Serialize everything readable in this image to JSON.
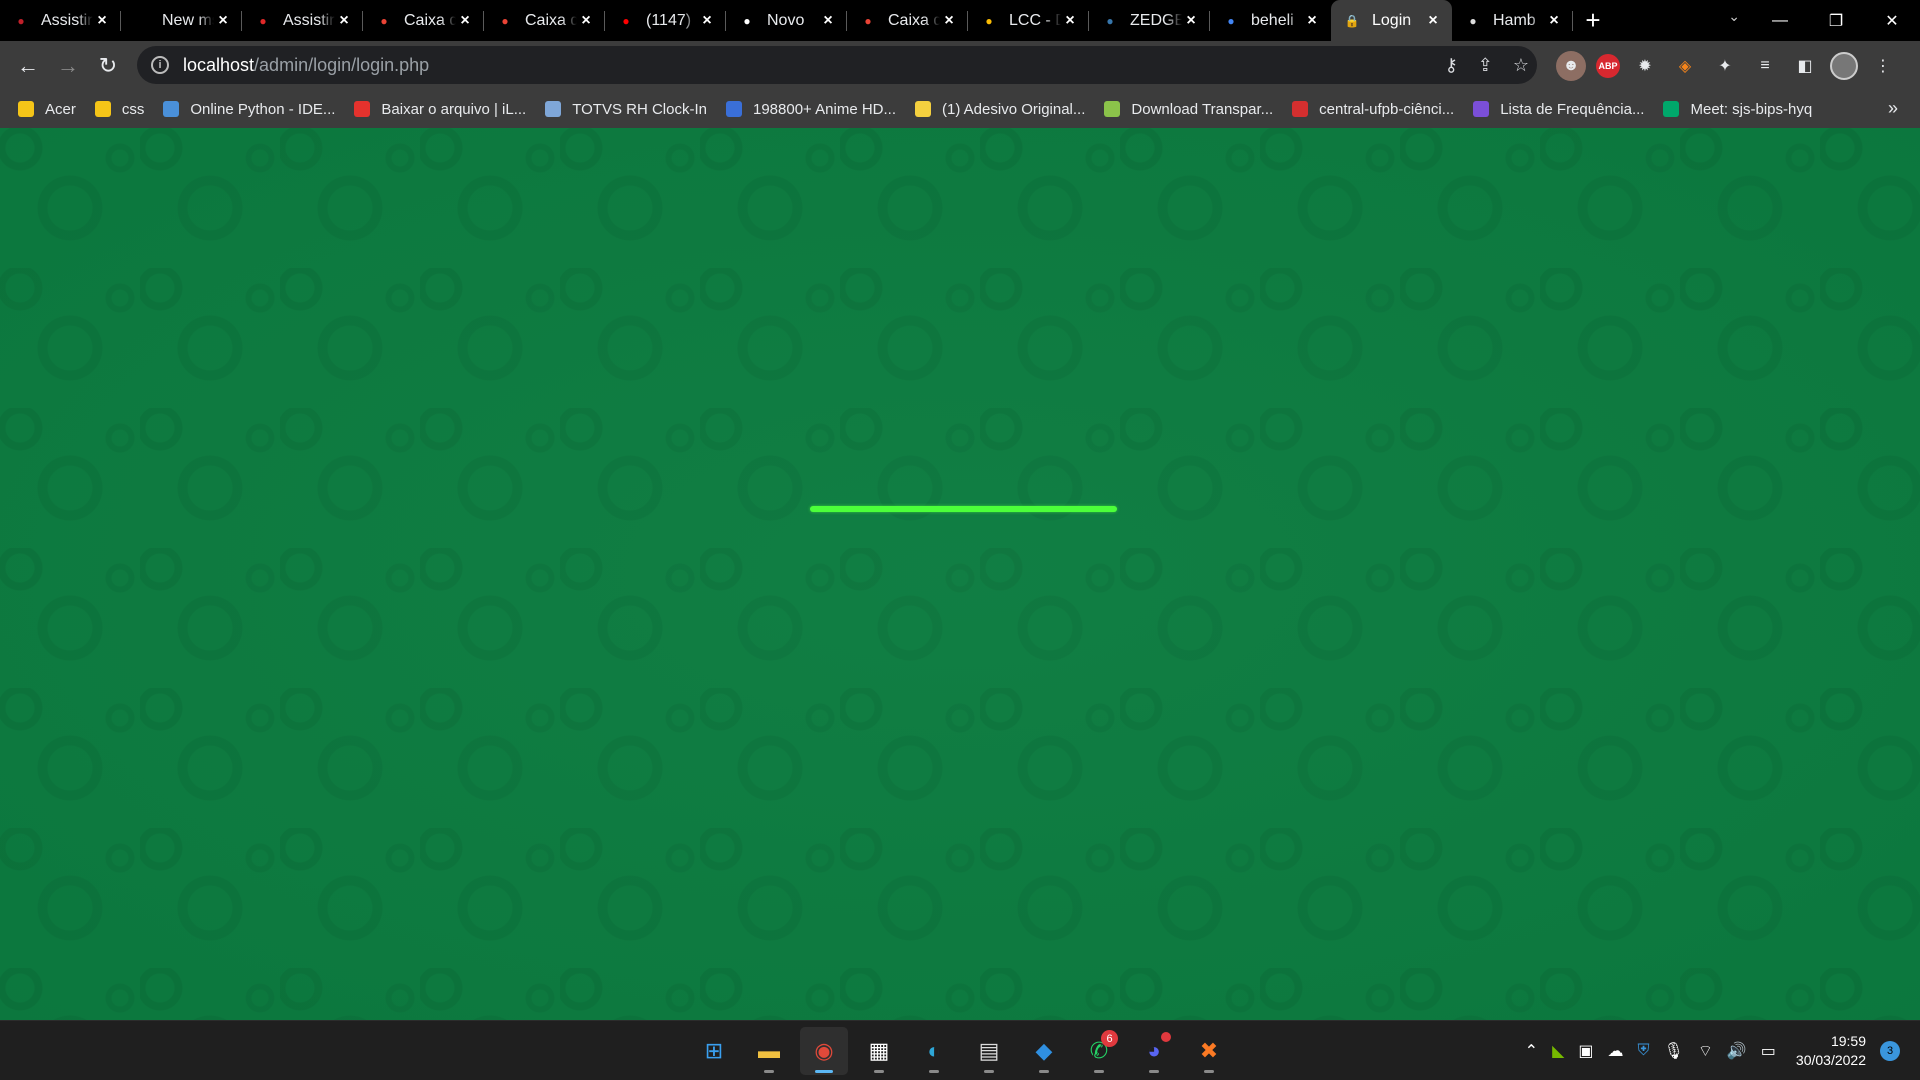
{
  "browser": {
    "tabs": [
      {
        "title": "Assistir",
        "favicon": "anime-site-icon",
        "color": "#c0202a"
      },
      {
        "title": "New msg",
        "favicon": "blank-icon",
        "color": "#000000"
      },
      {
        "title": "Assistir",
        "favicon": "youtube-style-icon",
        "color": "#e02828"
      },
      {
        "title": "Caixa de entrada",
        "favicon": "gmail-icon",
        "color": "#ea4335"
      },
      {
        "title": "Caixa de entrada",
        "favicon": "gmail-icon",
        "color": "#ea4335"
      },
      {
        "title": "(1147)",
        "favicon": "youtube-icon",
        "color": "#ff0000"
      },
      {
        "title": "Novo",
        "favicon": "github-icon",
        "color": "#ffffff"
      },
      {
        "title": "Caixa de entrada",
        "favicon": "gmail-icon",
        "color": "#ea4335"
      },
      {
        "title": "LCC - Drive",
        "favicon": "drive-icon",
        "color": "#fbbc04"
      },
      {
        "title": "ZEDGE",
        "favicon": "python-icon",
        "color": "#3776ab"
      },
      {
        "title": "beheli",
        "favicon": "google-icon",
        "color": "#4285f4"
      },
      {
        "title": "Login",
        "favicon": "lock-icon",
        "color": "#f5c518",
        "active": true
      },
      {
        "title": "Hamb",
        "favicon": "page-icon",
        "color": "#dddddd"
      }
    ],
    "url_host": "localhost",
    "url_path": "/admin/login/login.php",
    "bookmarks": [
      {
        "label": "Acer",
        "color": "#f5c518"
      },
      {
        "label": "css",
        "color": "#f5c518"
      },
      {
        "label": "Online Python - IDE...",
        "color": "#4a90d9"
      },
      {
        "label": "Baixar o arquivo | iL...",
        "color": "#e5322d"
      },
      {
        "label": "TOTVS RH Clock-In",
        "color": "#7fa7d8"
      },
      {
        "label": "198800+ Anime HD...",
        "color": "#3a6fd8"
      },
      {
        "label": "(1) Adesivo Original...",
        "color": "#f4d03f"
      },
      {
        "label": "Download Transpar...",
        "color": "#8bc34a"
      },
      {
        "label": "central-ufpb-ciênci...",
        "color": "#d32f2f"
      },
      {
        "label": "Lista de Frequência...",
        "color": "#7b4fd8"
      },
      {
        "label": "Meet: sjs-bips-hyq",
        "color": "#00a86b"
      }
    ]
  },
  "page": {
    "loader_color": "#4cff3a",
    "background_color": "#0c7c40"
  },
  "taskbar": {
    "apps": [
      {
        "name": "windows-start-icon",
        "glyph": "⊞",
        "color": "#3aa0f0"
      },
      {
        "name": "file-explorer-icon",
        "glyph": "▬",
        "color": "#f0c040"
      },
      {
        "name": "chrome-icon",
        "glyph": "◉",
        "color": "#e0493a",
        "active": true
      },
      {
        "name": "store-icon",
        "glyph": "▦",
        "color": "#ffffff"
      },
      {
        "name": "edge-icon",
        "glyph": "◐",
        "color": "#2ea7d8"
      },
      {
        "name": "notepad-icon",
        "glyph": "▤",
        "color": "#dddddd"
      },
      {
        "name": "vscode-icon",
        "glyph": "◆",
        "color": "#2f8fe0"
      },
      {
        "name": "whatsapp-icon",
        "glyph": "✆",
        "color": "#25d366",
        "badge": "6"
      },
      {
        "name": "discord-icon",
        "glyph": "◕",
        "color": "#5865f2",
        "badge_dot": true
      },
      {
        "name": "xampp-icon",
        "glyph": "✖",
        "color": "#fb7a24"
      }
    ],
    "time": "19:59",
    "date": "30/03/2022",
    "notifications": "3"
  }
}
